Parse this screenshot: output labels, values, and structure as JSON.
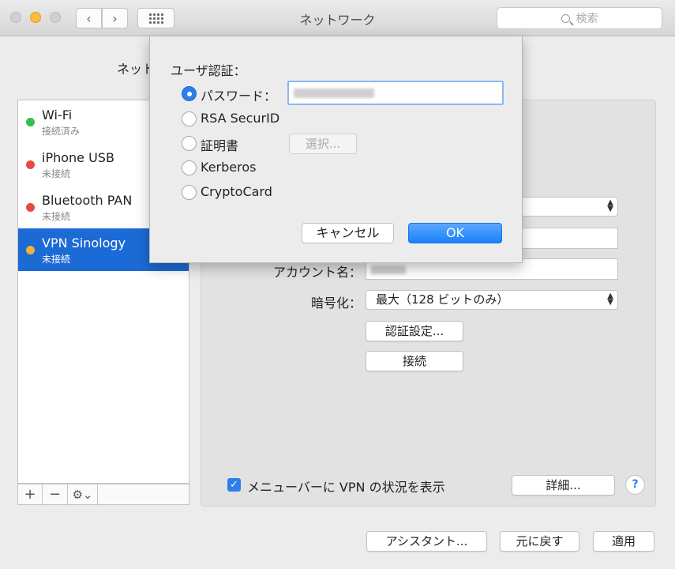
{
  "window": {
    "title": "ネットワーク",
    "search_placeholder": "検索"
  },
  "location_label": "ネット",
  "services": [
    {
      "name": "Wi-Fi",
      "status": "接続済み",
      "dot_color": "#34c04a"
    },
    {
      "name": "iPhone USB",
      "status": "未接続",
      "dot_color": "#e54a45"
    },
    {
      "name": "Bluetooth PAN",
      "status": "未接続",
      "dot_color": "#e54a45"
    },
    {
      "name": "VPN Sinology",
      "status": "未接続",
      "dot_color": "#f5b233",
      "selected": true
    }
  ],
  "sidebar_tools": {
    "add": "+",
    "remove": "−",
    "gear": "⚙⌄"
  },
  "detail": {
    "account_label": "アカウント名：",
    "encryption_label": "暗号化：",
    "encryption_value": "最大（128 ビットのみ）",
    "auth_settings_button": "認証設定...",
    "connect_button": "接続",
    "show_vpn_status_label": "メニューバーに VPN の状況を表示",
    "show_vpn_status_checked": true,
    "advanced_button": "詳細...",
    "help_button": "?"
  },
  "footer": {
    "assistant_button": "アシスタント...",
    "revert_button": "元に戻す",
    "apply_button": "適用"
  },
  "auth_sheet": {
    "heading": "ユーザ認証：",
    "options": [
      {
        "label": "パスワード：",
        "selected": true
      },
      {
        "label": "RSA SecurID",
        "selected": false
      },
      {
        "label": "証明書",
        "selected": false
      },
      {
        "label": "Kerberos",
        "selected": false
      },
      {
        "label": "CryptoCard",
        "selected": false
      }
    ],
    "select_button": "選択...",
    "cancel_button": "キャンセル",
    "ok_button": "OK"
  },
  "colors": {
    "accent": "#2d7fec",
    "selection": "#1c6ad6"
  }
}
